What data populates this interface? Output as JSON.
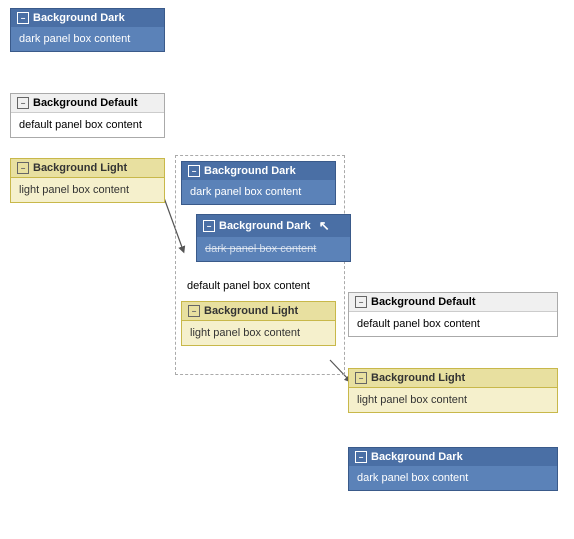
{
  "panels": {
    "top_left_dark": {
      "title": "Background Dark",
      "content": "dark panel box content",
      "type": "dark"
    },
    "top_left_default": {
      "title": "Background Default",
      "content": "default panel box content",
      "type": "default"
    },
    "top_left_light": {
      "title": "Background Light",
      "content": "light panel box content",
      "type": "light"
    },
    "mid_dark1": {
      "title": "Background Dark",
      "content": "dark panel box content",
      "type": "dark"
    },
    "mid_dark2": {
      "title": "Background Dark",
      "content": "dark panel box content",
      "type": "dark"
    },
    "mid_default": {
      "title": "default panel box content",
      "content": "default panel box content",
      "type": "default_inner"
    },
    "mid_light": {
      "title": "Background Light",
      "content": "light panel box content",
      "type": "light"
    },
    "right_default": {
      "title": "Background Default",
      "content": "default panel box content",
      "type": "default"
    },
    "right_light": {
      "title": "Background Light",
      "content": "light panel box content",
      "type": "light"
    },
    "right_dark": {
      "title": "Background Dark",
      "content": "dark panel box content",
      "type": "dark"
    }
  },
  "icon_minus": "−"
}
